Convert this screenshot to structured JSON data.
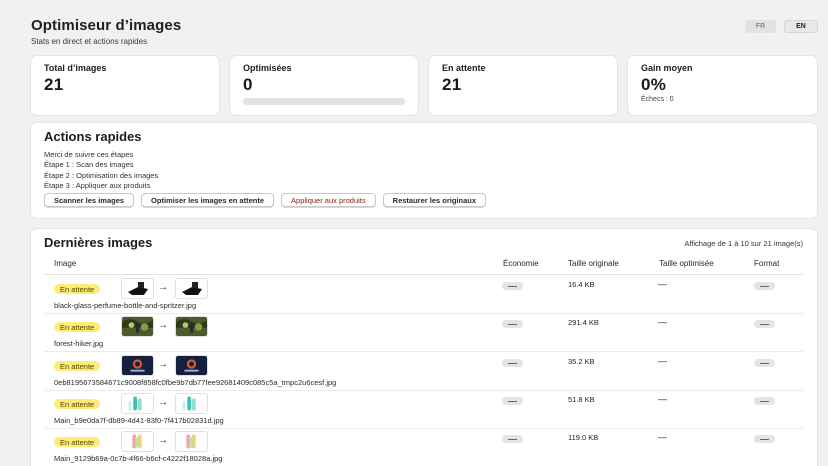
{
  "header": {
    "title": "Optimiseur d’images",
    "subtitle": "Stats en direct et actions rapides"
  },
  "lang": {
    "fr": "FR",
    "en": "EN",
    "active": "EN"
  },
  "stats": {
    "total": {
      "label": "Total d’images",
      "value": "21"
    },
    "optimized": {
      "label": "Optimisées",
      "value": "0",
      "progress": 0
    },
    "pending": {
      "label": "En attente",
      "value": "21"
    },
    "gain": {
      "label": "Gain moyen",
      "value": "0%",
      "failures": "Échecs : 0"
    }
  },
  "actions": {
    "title": "Actions rapides",
    "steps": [
      "Merci de suivre ces étapes",
      "Étape 1 : Scan des images",
      "Étape 2 : Optimisation des images",
      "Étape 3 : Appliquer aux produits"
    ],
    "buttons": {
      "scan": "Scanner les images",
      "optimize": "Optimiser les images en attente",
      "apply": "Appliquer aux produits",
      "restore": "Restaurer les originaux"
    }
  },
  "latest": {
    "title": "Dernières images",
    "showing": "Affichage de 1 à 10 sur 21 image(s)",
    "columns": {
      "image": "Image",
      "saving": "Économie",
      "original": "Taille originale",
      "optimized": "Taille optimisée",
      "format": "Format"
    },
    "rows": [
      {
        "status": "En attente",
        "filename": "black-glass-perfume-bottle-and-spritzer.jpg",
        "original_size": "16.4 KB",
        "optimized_size": "—",
        "thumb": "perfume"
      },
      {
        "status": "En attente",
        "filename": "forest-hiker.jpg",
        "original_size": "291.4 KB",
        "optimized_size": "—",
        "thumb": "forest"
      },
      {
        "status": "En attente",
        "filename": "0eb8195673584671c9008f858fc0fbe9b7db77fee92681409c085c5a_tmpc2u6cesf.jpg",
        "original_size": "35.2 KB",
        "optimized_size": "—",
        "thumb": "logo"
      },
      {
        "status": "En attente",
        "filename": "Main_b9e0da7f-db89-4d41-83f0-7f417b02831d.jpg",
        "original_size": "51.8 KB",
        "optimized_size": "—",
        "thumb": "teal-bottles"
      },
      {
        "status": "En attente",
        "filename": "Main_9129b69a-0c7b-4f66-b6cf-c4222f18028a.jpg",
        "original_size": "119.0 KB",
        "optimized_size": "—",
        "thumb": "pink-bottles"
      }
    ]
  },
  "arrow": "→",
  "colors": {
    "badge": "#ffeb78",
    "critical": "#8e1f0b",
    "progress": "#8a8a8a"
  }
}
